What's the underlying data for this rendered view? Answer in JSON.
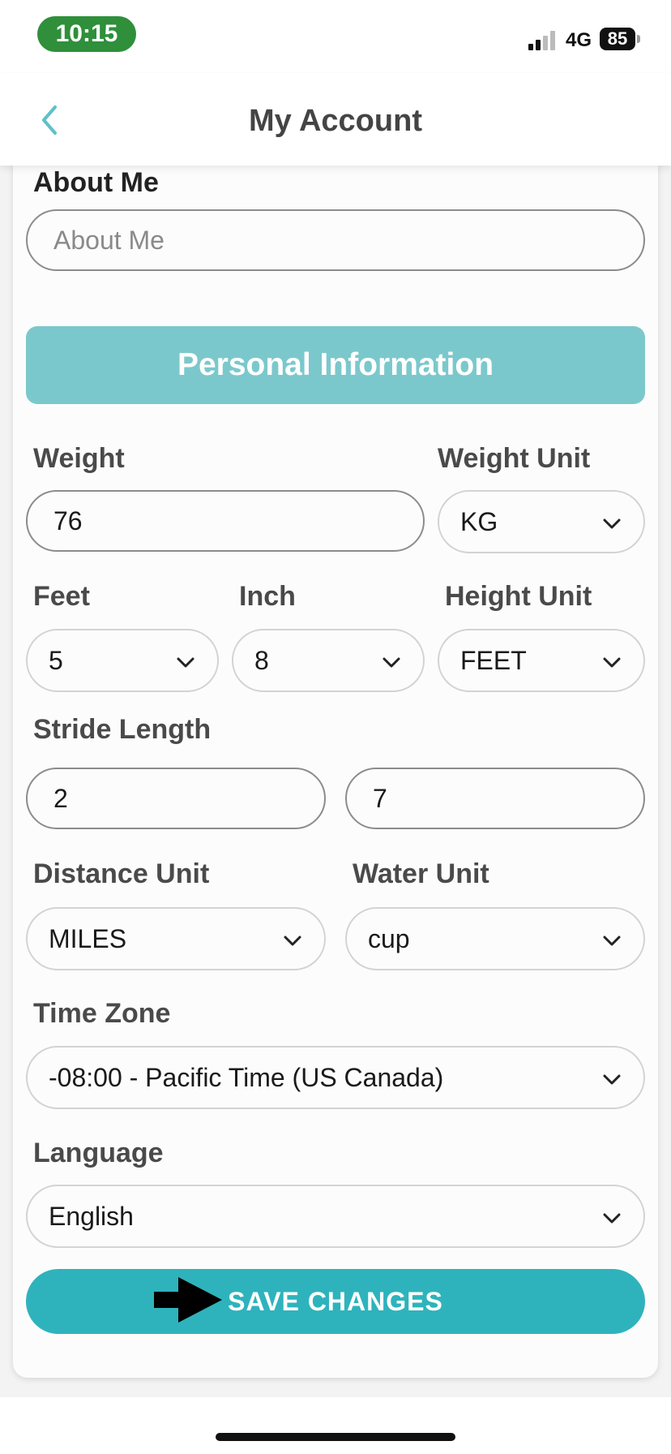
{
  "status_bar": {
    "time": "10:15",
    "network": "4G",
    "battery": "85"
  },
  "header": {
    "title": "My Account"
  },
  "about": {
    "label": "About Me",
    "placeholder": "About Me"
  },
  "section": {
    "personal_info": "Personal Information"
  },
  "weight": {
    "label": "Weight",
    "value": "76"
  },
  "weight_unit": {
    "label": "Weight Unit",
    "value": "KG"
  },
  "feet": {
    "label": "Feet",
    "value": "5"
  },
  "inch": {
    "label": "Inch",
    "value": "8"
  },
  "height_unit": {
    "label": "Height Unit",
    "value": "FEET"
  },
  "stride": {
    "label": "Stride Length",
    "value1": "2",
    "value2": "7"
  },
  "distance_unit": {
    "label": "Distance Unit",
    "value": "MILES"
  },
  "water_unit": {
    "label": "Water Unit",
    "value": "cup"
  },
  "time_zone": {
    "label": "Time Zone",
    "value": "-08:00 - Pacific Time (US Canada)"
  },
  "language": {
    "label": "Language",
    "value": "English"
  },
  "actions": {
    "save_label": "SAVE CHANGES"
  },
  "colors": {
    "accent": "#2eb3bc",
    "section_bg": "#7bc8cc",
    "clock_bg": "#2f8f3a",
    "back_icon": "#5fc0c8"
  },
  "icons": {
    "back": "chevron-left-icon",
    "dropdown": "chevron-down-icon",
    "annotation": "arrow-right-icon"
  }
}
